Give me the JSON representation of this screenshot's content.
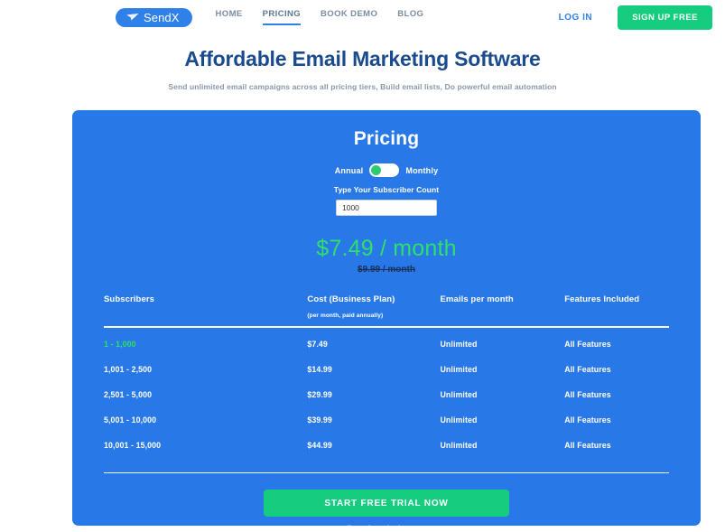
{
  "header": {
    "logo": {
      "icon": "paper-plane-icon",
      "text": "SendX"
    },
    "nav": [
      {
        "label": "HOME",
        "active": false
      },
      {
        "label": "PRICING",
        "active": true
      },
      {
        "label": "BOOK DEMO",
        "active": false
      },
      {
        "label": "BLOG",
        "active": false
      }
    ],
    "login_label": "LOG IN",
    "signup_label": "SIGN UP FREE"
  },
  "hero": {
    "title": "Affordable Email Marketing Software",
    "subtitle": "Send unlimited email campaigns across all pricing tiers, Build email lists, Do powerful email automation"
  },
  "pricing": {
    "title": "Pricing",
    "toggle": {
      "left_label": "Annual",
      "right_label": "Monthly",
      "selected": "Annual"
    },
    "subscriber_field": {
      "label": "Type Your Subscriber Count",
      "value": "1000",
      "placeholder": "1000"
    },
    "price_current": "$7.49 / month",
    "price_original": "$9.99 / month",
    "table": {
      "headers": {
        "subscribers": "Subscribers",
        "cost": "Cost (Business Plan)",
        "cost_note": "(per month, paid annually)",
        "emails": "Emails per month",
        "features": "Features Included"
      },
      "rows": [
        {
          "subscribers": "1 - 1,000",
          "cost": "$7.49",
          "emails": "Unlimited",
          "features": "All Features",
          "active": true
        },
        {
          "subscribers": "1,001 - 2,500",
          "cost": "$14.99",
          "emails": "Unlimited",
          "features": "All Features",
          "active": false
        },
        {
          "subscribers": "2,501 - 5,000",
          "cost": "$29.99",
          "emails": "Unlimited",
          "features": "All Features",
          "active": false
        },
        {
          "subscribers": "5,001 - 10,000",
          "cost": "$39.99",
          "emails": "Unlimited",
          "features": "All Features",
          "active": false
        },
        {
          "subscribers": "10,001 - 15,000",
          "cost": "$44.99",
          "emails": "Unlimited",
          "features": "All Features",
          "active": false
        }
      ]
    },
    "cta_label": "START FREE TRIAL NOW",
    "cta_note": "No credit card required. Instant setup."
  },
  "colors": {
    "brand_blue": "#2878e8",
    "accent_green": "#15cc7f",
    "price_green": "#2ee06a",
    "hero_navy": "#1b4b8f"
  }
}
